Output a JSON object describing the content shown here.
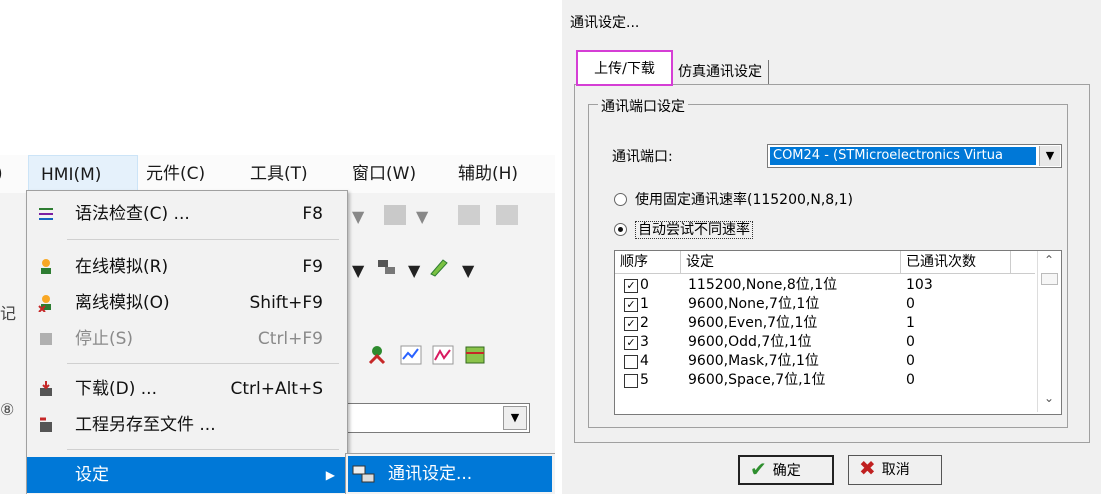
{
  "menubar": {
    "bracket": ")",
    "items": [
      "HMI(M)",
      "元件(C)",
      "工具(T)",
      "窗口(W)",
      "辅助(H)"
    ]
  },
  "hmi_menu": {
    "syntax_check": {
      "label": "语法检查(C) ...",
      "key": "F8"
    },
    "online_sim": {
      "label": "在线模拟(R)",
      "key": "F9"
    },
    "offline_sim": {
      "label": "离线模拟(O)",
      "key": "Shift+F9"
    },
    "stop": {
      "label": "停止(S)",
      "key": "Ctrl+F9"
    },
    "download": {
      "label": "下载(D) ...",
      "key": "Ctrl+Alt+S"
    },
    "save_project": {
      "label": "工程另存至文件 ..."
    },
    "settings": {
      "label": "设定",
      "arrow": "▶"
    }
  },
  "submenu": {
    "comm_settings": "通讯设定..."
  },
  "left_misc": {
    "label_fragment": "记",
    "circled": "⑧",
    "combo_arrow": "▼"
  },
  "dialog": {
    "title": "通讯设定...",
    "tabs": [
      "上传/下载",
      "仿真通讯设定"
    ],
    "group_title": "通讯端口设定",
    "port_label": "通讯端口:",
    "port_value": "COM24 - (STMicroelectronics Virtua",
    "radio_fixed": "使用固定通讯速率(115200,N,8,1)",
    "radio_auto": "自动尝试不同速率",
    "list": {
      "headers": [
        "顺序",
        "设定",
        "已通讯次数"
      ],
      "rows": [
        {
          "checked": true,
          "seq": "0",
          "setting": "115200,None,8位,1位",
          "count": "103"
        },
        {
          "checked": true,
          "seq": "1",
          "setting": "9600,None,7位,1位",
          "count": "0"
        },
        {
          "checked": true,
          "seq": "2",
          "setting": "9600,Even,7位,1位",
          "count": "1"
        },
        {
          "checked": true,
          "seq": "3",
          "setting": "9600,Odd,7位,1位",
          "count": "0"
        },
        {
          "checked": false,
          "seq": "4",
          "setting": "9600,Mask,7位,1位",
          "count": "0"
        },
        {
          "checked": false,
          "seq": "5",
          "setting": "9600,Space,7位,1位",
          "count": "0"
        }
      ]
    },
    "ok_label": "确定",
    "cancel_label": "取消"
  },
  "colors": {
    "highlight": "#0078d7",
    "tab_outline": "#d53ed5",
    "ok_green": "#2f8f2f",
    "cancel_red": "#c02020"
  }
}
